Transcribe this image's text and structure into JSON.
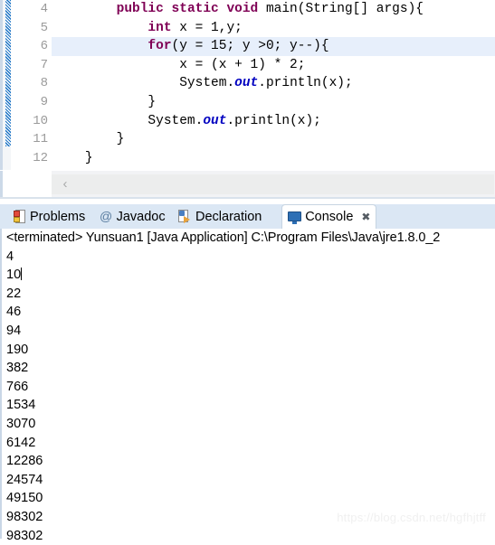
{
  "editor": {
    "lines": [
      {
        "number": "4",
        "folded": true,
        "highlighted": false,
        "indent": 8,
        "segments": [
          {
            "t": "public static void ",
            "s": "kw"
          },
          {
            "t": "main(String[] args){",
            "s": "plain"
          }
        ]
      },
      {
        "number": "5",
        "folded": false,
        "highlighted": false,
        "indent": 12,
        "segments": [
          {
            "t": "int",
            "s": "kw"
          },
          {
            "t": " x = 1,y;",
            "s": "plain"
          }
        ]
      },
      {
        "number": "6",
        "folded": false,
        "highlighted": true,
        "indent": 12,
        "segments": [
          {
            "t": "for",
            "s": "kw"
          },
          {
            "t": "(y = 15; y >0; y--){",
            "s": "plain"
          }
        ]
      },
      {
        "number": "7",
        "folded": false,
        "highlighted": false,
        "indent": 16,
        "segments": [
          {
            "t": "x = (x + 1) * 2;",
            "s": "plain"
          }
        ]
      },
      {
        "number": "8",
        "folded": false,
        "highlighted": false,
        "indent": 16,
        "segments": [
          {
            "t": "System.",
            "s": "plain"
          },
          {
            "t": "out",
            "s": "fieldblue"
          },
          {
            "t": ".println(x);",
            "s": "plain"
          }
        ]
      },
      {
        "number": "9",
        "folded": false,
        "highlighted": false,
        "indent": 12,
        "segments": [
          {
            "t": "}",
            "s": "plain"
          }
        ]
      },
      {
        "number": "10",
        "folded": false,
        "highlighted": false,
        "indent": 12,
        "segments": [
          {
            "t": "System.",
            "s": "plain"
          },
          {
            "t": "out",
            "s": "fieldblue"
          },
          {
            "t": ".println(x);",
            "s": "plain"
          }
        ]
      },
      {
        "number": "11",
        "folded": false,
        "highlighted": false,
        "indent": 8,
        "segments": [
          {
            "t": "}",
            "s": "plain"
          }
        ]
      },
      {
        "number": "12",
        "folded": false,
        "highlighted": false,
        "indent": 4,
        "segments": [
          {
            "t": "}",
            "s": "plain"
          }
        ]
      }
    ],
    "scrollbar": {
      "left_arrow_glyph": "‹"
    }
  },
  "tabs": [
    {
      "label": "Problems",
      "icon": "problems-icon",
      "active": false,
      "closable": false
    },
    {
      "label": "Javadoc",
      "icon": "javadoc-icon",
      "active": false,
      "closable": false
    },
    {
      "label": "Declaration",
      "icon": "declaration-icon",
      "active": false,
      "closable": false
    },
    {
      "label": "Console",
      "icon": "console-icon",
      "active": true,
      "closable": true,
      "close_glyph": "✖"
    }
  ],
  "console": {
    "header": "<terminated> Yunsuan1 [Java Application] C:\\Program Files\\Java\\jre1.8.0_2",
    "output": [
      "4",
      "10",
      "22",
      "46",
      "94",
      "190",
      "382",
      "766",
      "1534",
      "3070",
      "6142",
      "12286",
      "24574",
      "49150",
      "98302",
      "98302"
    ],
    "caret_after_line_index": 1
  },
  "watermark": {
    "text": "https://blog.csdn.net/hgfhjtff"
  },
  "colors": {
    "keyword": "#7f0055",
    "field": "#0000c0",
    "highlight_line": "#e7effb",
    "tabbar": "#dbe7f4",
    "accent_blue": "#2d6fb5"
  }
}
